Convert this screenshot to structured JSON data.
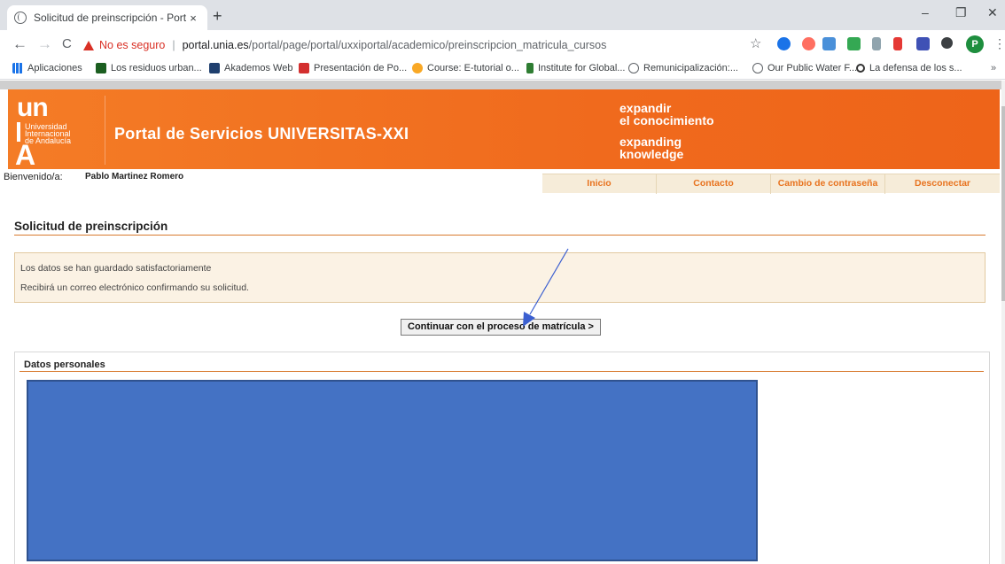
{
  "browser": {
    "tab_title": "Solicitud de preinscripción - Port",
    "tab_close": "×",
    "new_tab": "+",
    "window_controls": {
      "minimize": "–",
      "restore": "❐",
      "close": "✕"
    },
    "nav": {
      "back": "←",
      "forward": "→",
      "reload": "C"
    },
    "security_label": "No es seguro",
    "url_separator": "|",
    "url_host": "portal.unia.es",
    "url_path": "/portal/page/portal/uxxiportal/academico/preinscripcion_matricula_cursos",
    "bookmark_star": "☆",
    "profile_initial": "P",
    "menu_icon": "⋮",
    "bookmarks_overflow": "»",
    "bookmarks": [
      {
        "label": "Aplicaciones",
        "icon_color": "#1a73e8"
      },
      {
        "label": "Los residuos urban...",
        "icon_color": "#1b5e20"
      },
      {
        "label": "Akademos Web",
        "icon_color": "#1f3f6e"
      },
      {
        "label": "Presentación de Po...",
        "icon_color": "#d32f2f"
      },
      {
        "label": "Course: E-tutorial o...",
        "icon_color": "#f9a825"
      },
      {
        "label": "Institute for Global...",
        "icon_color": "#2e7d32"
      },
      {
        "label": "Remunicipalización:...",
        "icon_color": "#5f6368"
      },
      {
        "label": "Our Public Water F...",
        "icon_color": "#5f6368"
      },
      {
        "label": "La defensa de los s...",
        "icon_color": "#333333"
      }
    ]
  },
  "header": {
    "logo": {
      "un": "un",
      "line1": "Universidad",
      "line2": "Internacional",
      "line3": "de Andalucía",
      "letter": "A"
    },
    "portal_title": "Portal de Servicios UNIVERSITAS-XXI",
    "slogan": [
      "expandir",
      "el conocimiento",
      "expanding",
      "knowledge"
    ]
  },
  "user_bar": {
    "welcome_label": "Bienvenido/a:",
    "user_name": "Pablo Martinez Romero"
  },
  "menu": [
    {
      "label": "Inicio"
    },
    {
      "label": "Contacto"
    },
    {
      "label": "Cambio de contraseña"
    },
    {
      "label": "Desconectar"
    }
  ],
  "content": {
    "section_title": "Solicitud de preinscripción",
    "notice_line1": "Los datos se han guardado satisfactoriamente",
    "notice_line2": "Recibirá un correo electrónico confirmando su solicitud.",
    "continue_button": "Continuar con el proceso de matrícula >",
    "panel_title": "Datos personales"
  },
  "colors": {
    "brand_orange": "#f06a1d",
    "menu_text": "#e8731f",
    "redaction_fill": "#4472c4",
    "annotation_arrow": "#3b5fd0"
  }
}
